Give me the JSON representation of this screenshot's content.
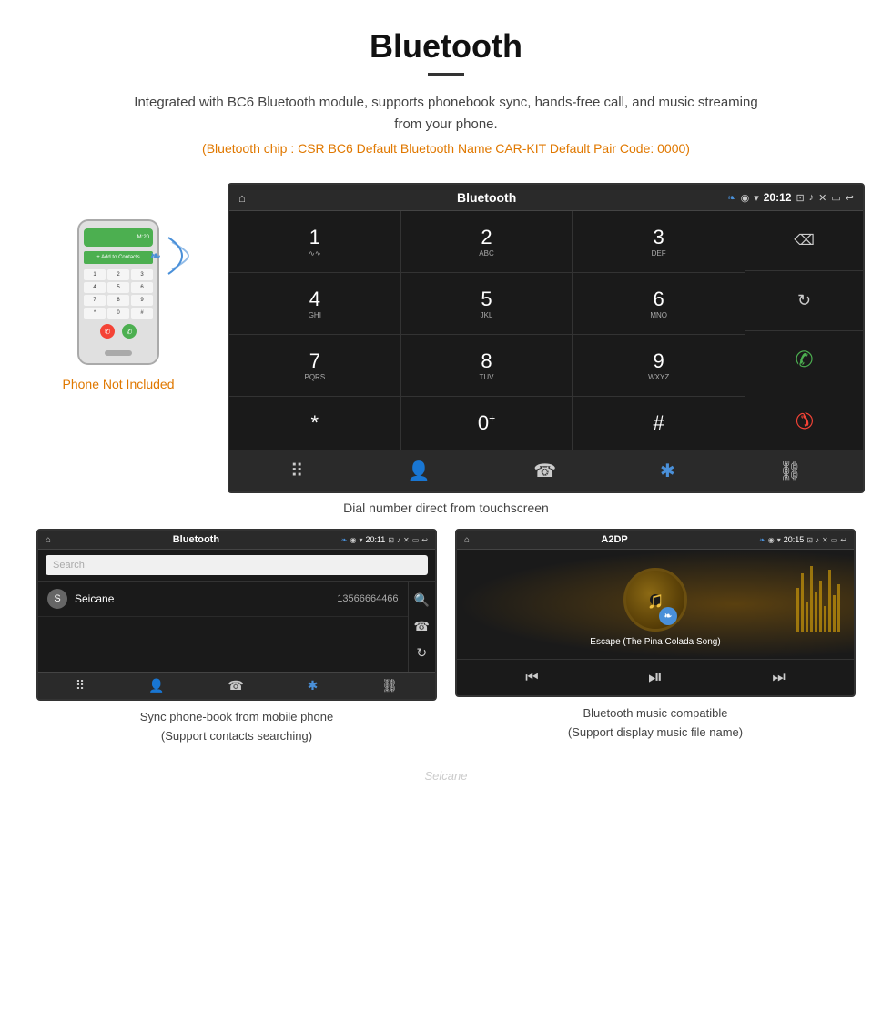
{
  "page": {
    "title": "Bluetooth",
    "divider": true,
    "description": "Integrated with BC6 Bluetooth module, supports phonebook sync, hands-free call, and music streaming from your phone.",
    "specs": "(Bluetooth chip : CSR BC6   Default Bluetooth Name CAR-KIT    Default Pair Code: 0000)",
    "dial_caption": "Dial number direct from touchscreen",
    "phonebook_caption_line1": "Sync phone-book from mobile phone",
    "phonebook_caption_line2": "(Support contacts searching)",
    "music_caption_line1": "Bluetooth music compatible",
    "music_caption_line2": "(Support display music file name)",
    "watermark": "Seicane"
  },
  "phone_label": "Phone Not Included",
  "dial_screen": {
    "header_title": "Bluetooth",
    "header_time": "20:12",
    "keys": [
      {
        "num": "1",
        "letters": "∿∿"
      },
      {
        "num": "2",
        "letters": "ABC"
      },
      {
        "num": "3",
        "letters": "DEF"
      },
      {
        "num": "4",
        "letters": "GHI"
      },
      {
        "num": "5",
        "letters": "JKL"
      },
      {
        "num": "6",
        "letters": "MNO"
      },
      {
        "num": "7",
        "letters": "PQRS"
      },
      {
        "num": "8",
        "letters": "TUV"
      },
      {
        "num": "9",
        "letters": "WXYZ"
      },
      {
        "num": "*",
        "letters": ""
      },
      {
        "num": "0",
        "letters": "+"
      },
      {
        "num": "#",
        "letters": ""
      }
    ],
    "nav_items": [
      "⠿",
      "👤",
      "☎",
      "✱",
      "⛓"
    ]
  },
  "phonebook_screen": {
    "header_title": "Bluetooth",
    "header_time": "20:11",
    "search_placeholder": "Search",
    "contacts": [
      {
        "initial": "S",
        "name": "Seicane",
        "number": "13566664466"
      }
    ],
    "nav_items": [
      "⠿",
      "👤",
      "☎",
      "✱",
      "⛓"
    ]
  },
  "music_screen": {
    "header_title": "A2DP",
    "header_time": "20:15",
    "song_title": "Escape (The Pina Colada Song)",
    "controls": [
      "⏮",
      "⏯",
      "⏭"
    ]
  },
  "colors": {
    "accent_orange": "#e07800",
    "screen_bg": "#1a1a1a",
    "green_call": "#4caf50",
    "red_call": "#f44336",
    "bluetooth_blue": "#4a90d9"
  }
}
